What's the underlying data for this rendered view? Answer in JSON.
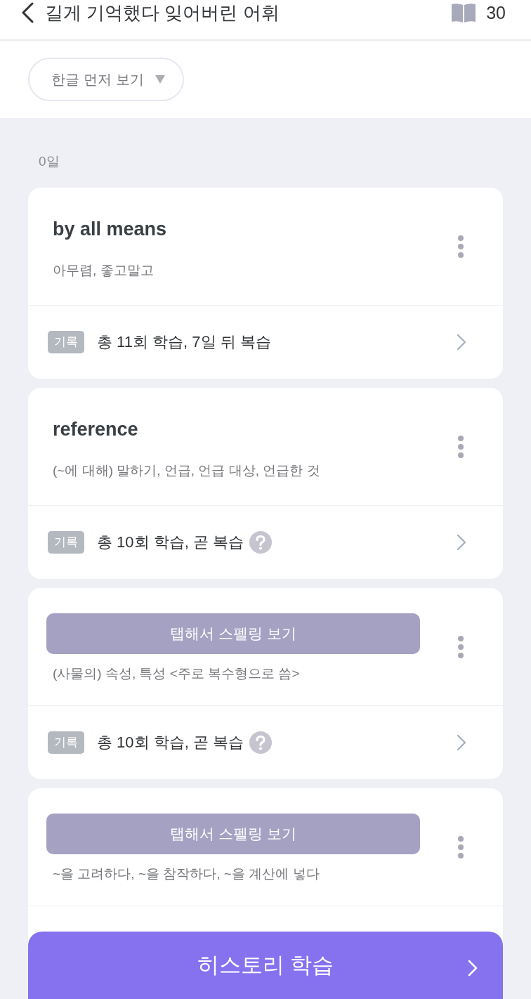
{
  "header": {
    "title": "길게 기억했다 잊어버린 어휘",
    "count": "30"
  },
  "filter": {
    "label": "한글 먼저 보기"
  },
  "groups": [
    {
      "label": "0일",
      "cards": [
        {
          "kind": "word",
          "word": "by all means",
          "meaning": "아무렴, 좋고말고",
          "record": {
            "badge": "기록",
            "text": "총 11회 학습, 7일 뒤 복습",
            "help": false
          }
        },
        {
          "kind": "word",
          "word": "reference",
          "meaning": "(~에 대해) 말하기, 언급, 언급 대상, 언급한 것",
          "record": {
            "badge": "기록",
            "text": "총 10회 학습, 곧 복습",
            "help": true
          }
        },
        {
          "kind": "hidden",
          "spelling_button": "탭해서 스펠링 보기",
          "meaning": "(사물의) 속성, 특성 <주로 복수형으로 씀>",
          "record": {
            "badge": "기록",
            "text": "총 10회 학습, 곧 복습",
            "help": true
          }
        },
        {
          "kind": "hidden",
          "spelling_button": "탭해서 스펠링 보기",
          "meaning": "~을 고려하다, ~을 참작하다, ~을 계산에 넣다"
        }
      ]
    }
  ],
  "bottom_button": {
    "label": "히스토리 학습"
  }
}
